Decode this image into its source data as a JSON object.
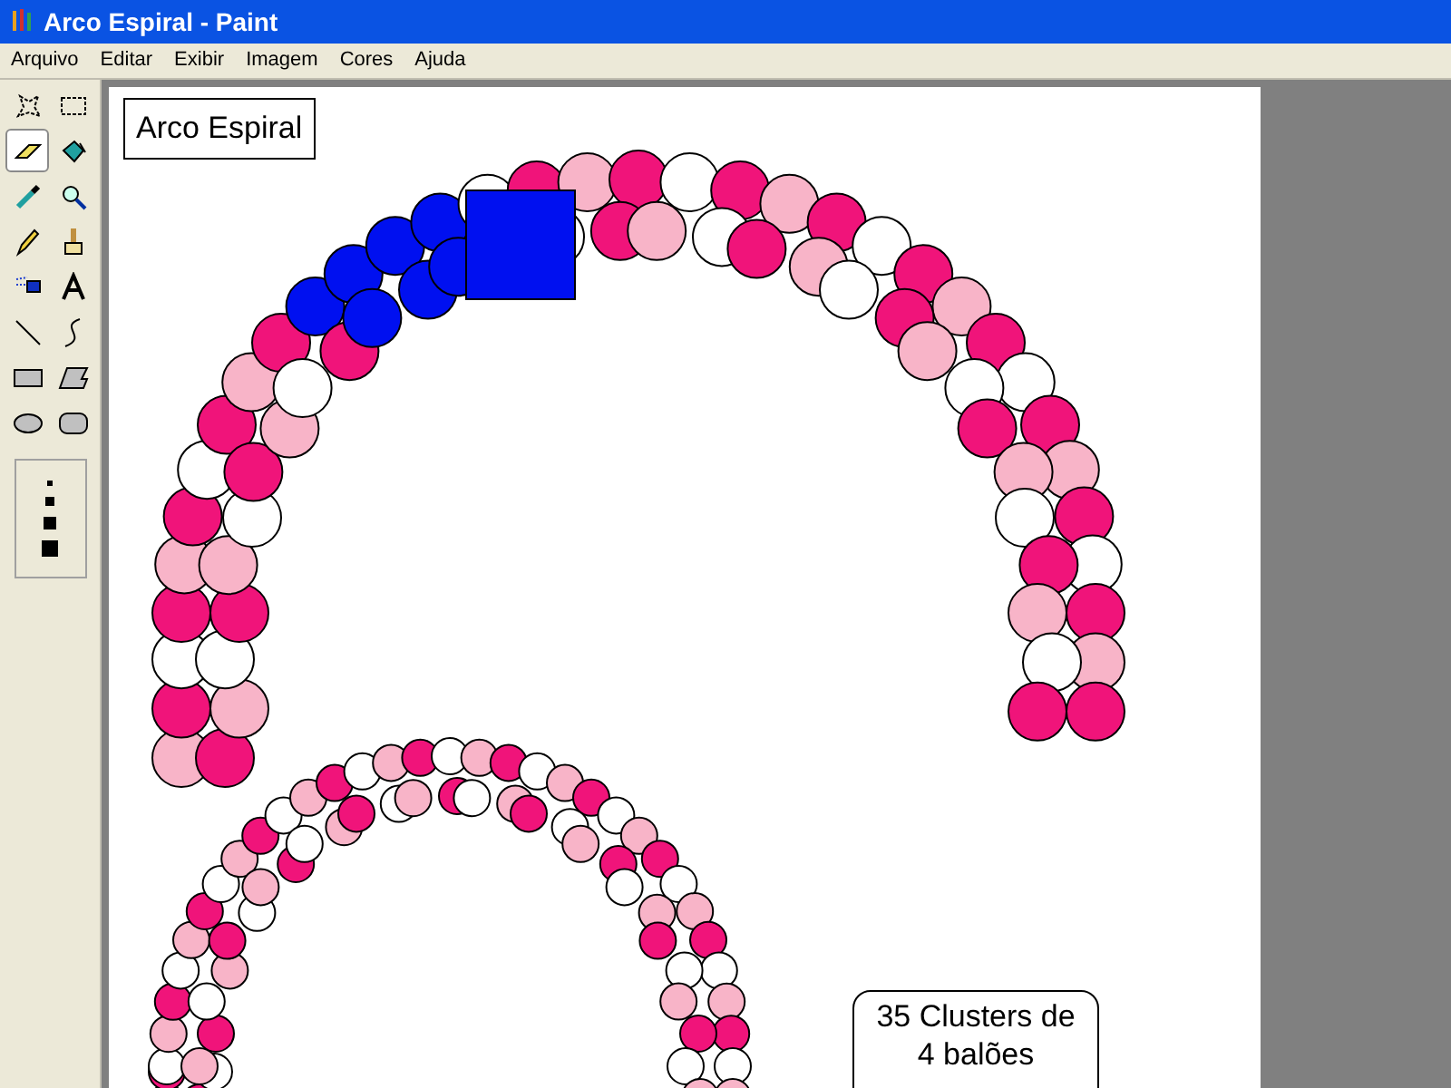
{
  "window": {
    "title": "Arco Espiral - Paint"
  },
  "menu": [
    "Arquivo",
    "Editar",
    "Exibir",
    "Imagem",
    "Cores",
    "Ajuda"
  ],
  "tools": [
    {
      "kind": "free-select",
      "selected": false
    },
    {
      "kind": "select",
      "selected": false
    },
    {
      "kind": "eraser",
      "selected": true
    },
    {
      "kind": "fill",
      "selected": false
    },
    {
      "kind": "picker",
      "selected": false
    },
    {
      "kind": "magnifier",
      "selected": false
    },
    {
      "kind": "pencil",
      "selected": false
    },
    {
      "kind": "brush",
      "selected": false
    },
    {
      "kind": "airbrush",
      "selected": false
    },
    {
      "kind": "text",
      "selected": false
    },
    {
      "kind": "line",
      "selected": false
    },
    {
      "kind": "curve",
      "selected": false
    },
    {
      "kind": "rectangle",
      "selected": false
    },
    {
      "kind": "polygon",
      "selected": false
    },
    {
      "kind": "ellipse",
      "selected": false
    },
    {
      "kind": "rounded-rectangle",
      "selected": false
    }
  ],
  "canvas": {
    "title_label": "Arco Espiral",
    "cluster_note": [
      "35 Clusters de",
      "4 balões"
    ]
  }
}
